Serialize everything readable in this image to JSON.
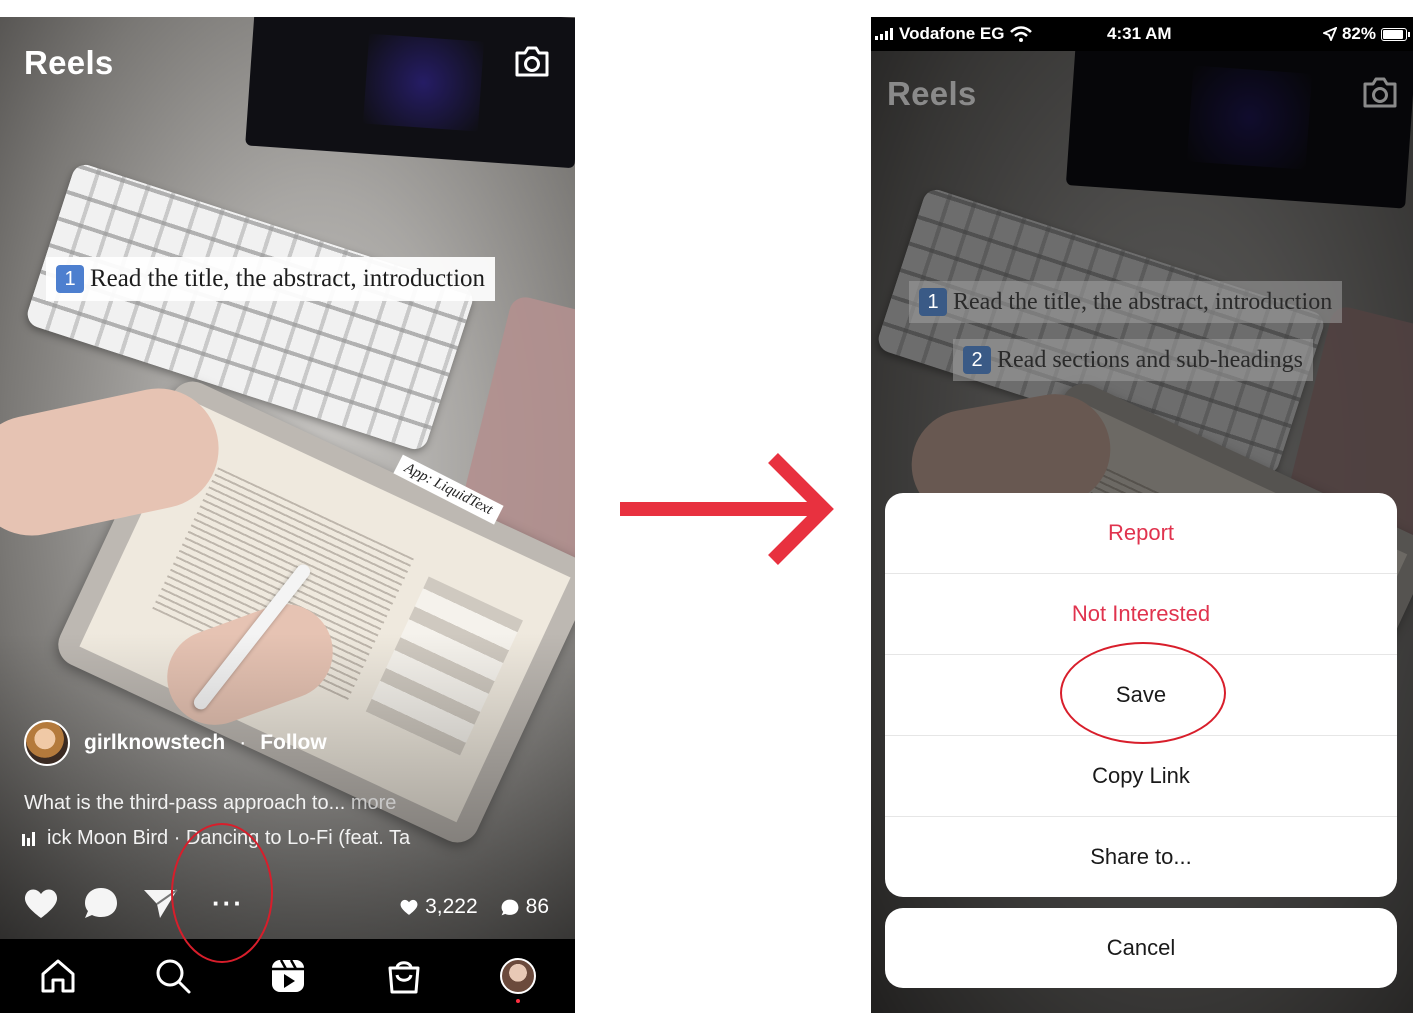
{
  "left_screen": {
    "title": "Reels",
    "caption_number": "1",
    "caption_text": "Read the title, the abstract, introduction",
    "app_tag": "App: LiquidText",
    "username": "girlknowstech",
    "separator": "·",
    "follow_label": "Follow",
    "description": "What is the third-pass approach to...",
    "more_label": "more",
    "music_text": "ick Moon Bird · Dancing to Lo-Fi (feat. Ta",
    "likes_count": "3,222",
    "comments_count": "86",
    "icons": [
      "heart-icon",
      "comment-icon",
      "share-icon",
      "more-options-icon",
      "home-icon",
      "search-icon",
      "reels-icon",
      "shop-icon",
      "profile-avatar"
    ]
  },
  "right_screen": {
    "status_bar": {
      "carrier": "Vodafone EG",
      "time": "4:31 AM",
      "battery": "82%"
    },
    "title": "Reels",
    "caption_1_number": "1",
    "caption_1_text": "Read the title, the abstract, introduction",
    "caption_2_number": "2",
    "caption_2_text": "Read sections and sub-headings",
    "menu": {
      "report": "Report",
      "not_interested": "Not Interested",
      "save": "Save",
      "copy_link": "Copy Link",
      "share_to": "Share to...",
      "cancel": "Cancel"
    }
  },
  "colors": {
    "annotation_red": "#d81e2b",
    "arrow_red": "#e8313f",
    "danger_text": "#e0334e",
    "badge_blue": "#4d7fcf"
  }
}
